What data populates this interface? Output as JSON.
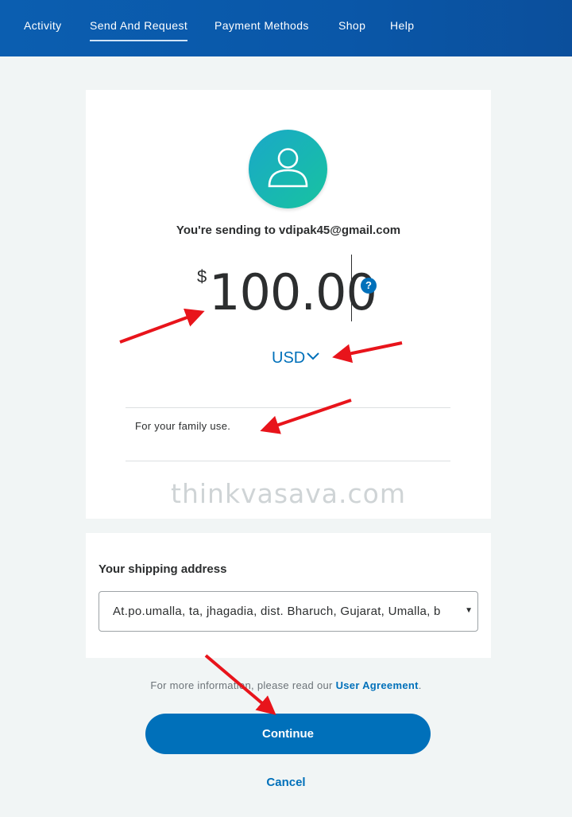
{
  "nav": {
    "items": [
      {
        "label": "Activity"
      },
      {
        "label": "Send And Request"
      },
      {
        "label": "Payment Methods"
      },
      {
        "label": "Shop"
      },
      {
        "label": "Help"
      }
    ],
    "active": "Send And Request"
  },
  "send": {
    "recipient_text": "You're sending to vdipak45@gmail.com",
    "currency_symbol": "$",
    "amount": "100.00",
    "currency_code": "USD",
    "help_icon": "?",
    "note": "For your family use."
  },
  "watermark": "thinkvasava.com",
  "shipping": {
    "label": "Your shipping address",
    "selected": "At.po.umalla, ta, jhagadia, dist. Bharuch, Gujarat, Umalla, b"
  },
  "agreement": {
    "prefix": "For more information, please read our ",
    "link": "User Agreement",
    "suffix": "."
  },
  "actions": {
    "continue_label": "Continue",
    "cancel_label": "Cancel"
  },
  "colors": {
    "nav_bg": "#0b5eb0",
    "primary": "#0070ba",
    "avatar_start": "#1aa8c8",
    "avatar_end": "#17c3a0",
    "annotation_arrow": "#e8141b"
  },
  "icons": {
    "avatar": "user-silhouette-icon",
    "help": "question-circle-icon",
    "currency_dropdown": "chevron-down-icon",
    "select_arrow": "caret-down-icon"
  }
}
